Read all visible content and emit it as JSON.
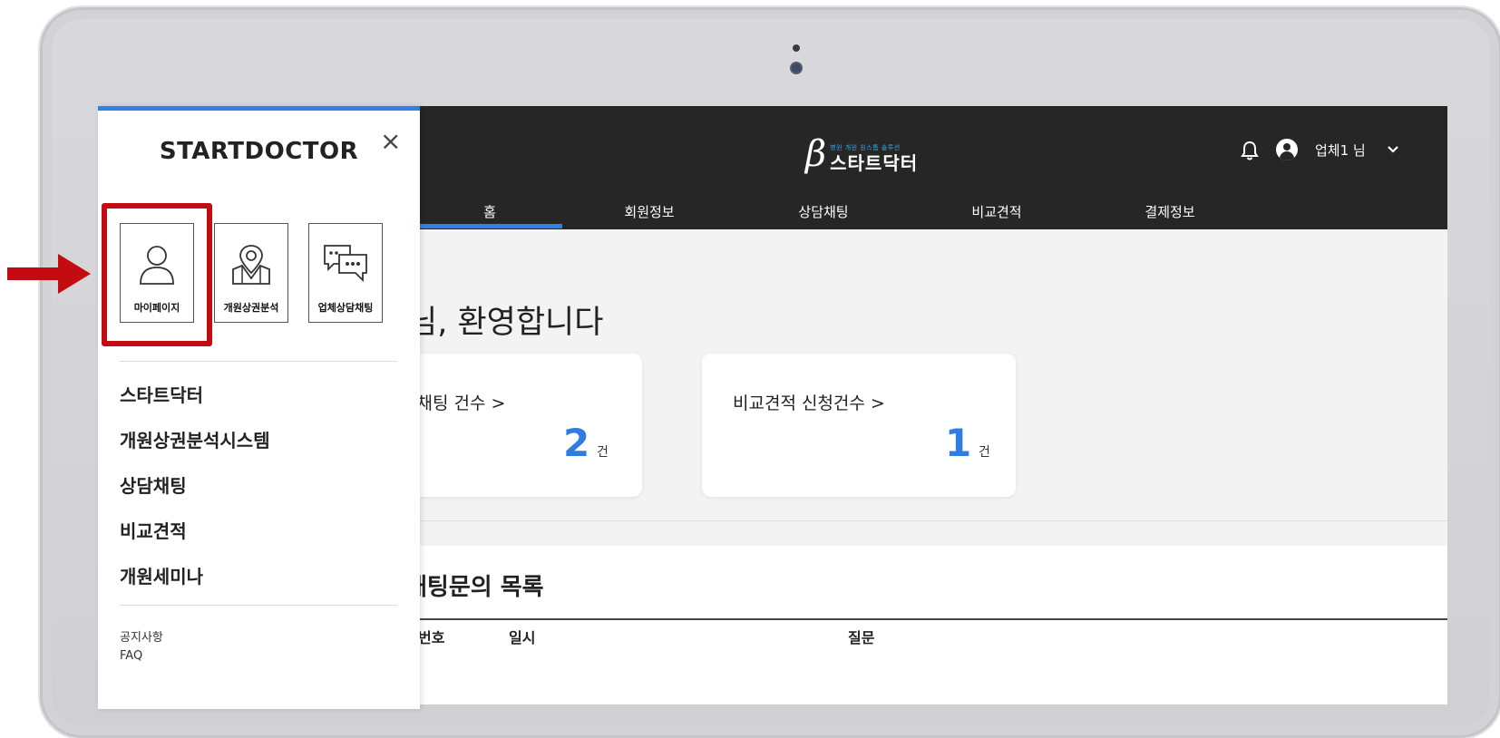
{
  "app": {
    "logo_mark": "β",
    "logo_subtitle": "병원 개원 원스톱 솔루션",
    "logo_name": "스타트닥터",
    "user_label": "업체1 님"
  },
  "tabs": [
    {
      "label": "홈"
    },
    {
      "label": "회원정보"
    },
    {
      "label": "상담채팅"
    },
    {
      "label": "비교견적"
    },
    {
      "label": "결제정보"
    }
  ],
  "main": {
    "welcome": "님, 환영합니다",
    "cards": [
      {
        "title": "인 채팅 건수 >",
        "value": "2",
        "unit": "건"
      },
      {
        "title": "비교견적 신청건수 >",
        "value": "1",
        "unit": "건"
      }
    ],
    "chat_section": {
      "title": "채팅문의 목록",
      "columns": [
        "번호",
        "일시",
        "질문"
      ]
    }
  },
  "drawer": {
    "brand": "STARTDOCTOR",
    "close_symbol": "×",
    "quick_links": [
      {
        "label": "마이페이지",
        "icon": "user-icon"
      },
      {
        "label": "개원상권분석",
        "icon": "map-pin-icon"
      },
      {
        "label": "업체상담채팅",
        "icon": "chat-bubbles-icon"
      }
    ],
    "menu": [
      "스타트닥터",
      "개원상권분석시스템",
      "상담채팅",
      "비교견적",
      "개원세미나"
    ],
    "sub_menu": [
      "공지사항",
      "FAQ"
    ]
  },
  "colors": {
    "accent": "#2f80ed",
    "header": "#262626",
    "highlight": "#c50b12"
  }
}
